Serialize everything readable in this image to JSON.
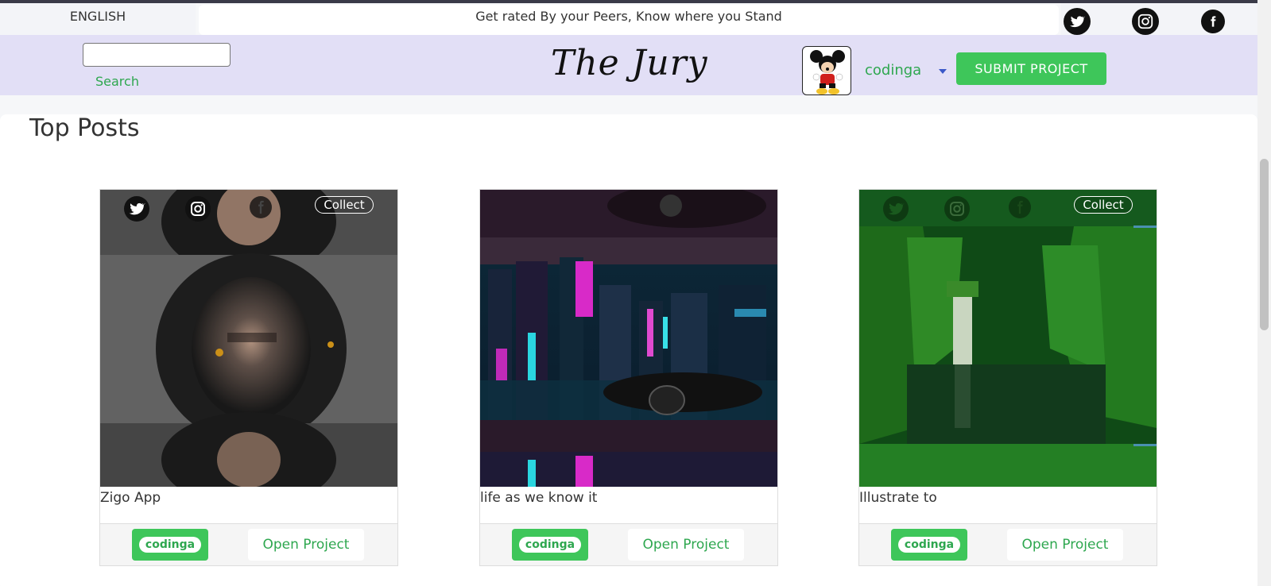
{
  "header": {
    "language": "ENGLISH",
    "tagline": "Get rated By your Peers, Know where you Stand"
  },
  "nav": {
    "search_placeholder": "",
    "search_label": "Search",
    "brand": "The Jury",
    "username": "codinga",
    "submit_label": "SUBMIT PROJECT"
  },
  "main": {
    "title": "Top Posts",
    "cards": [
      {
        "title": "Zigo App",
        "author": "codinga",
        "open_label": "Open Project",
        "collect_label": "Collect"
      },
      {
        "title": "life as we know it",
        "author": "codinga",
        "open_label": "Open Project"
      },
      {
        "title": "Illustrate to",
        "author": "codinga",
        "open_label": "Open Project",
        "collect_label": "Collect"
      }
    ]
  },
  "colors": {
    "accent_green": "#3ec65a",
    "nav_bg": "#e2dff6"
  }
}
